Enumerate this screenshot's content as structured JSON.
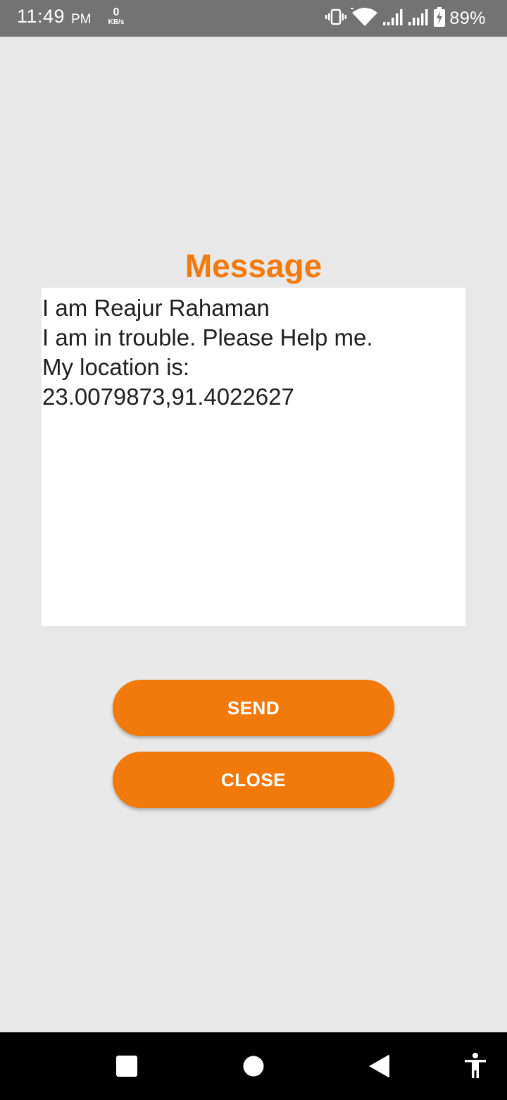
{
  "status_bar": {
    "time": "11:49",
    "ampm": "PM",
    "net_speed_value": "0",
    "net_speed_unit": "KB/s",
    "battery_percent": "89%",
    "icons": [
      "vibrate-icon",
      "wifi-icon",
      "signal-icon",
      "signal-icon",
      "battery-charging-icon"
    ],
    "background_color": "#737373"
  },
  "main": {
    "title": "Message",
    "message_text": "I am Reajur Rahaman\nI am in trouble. Please Help me.\nMy location is:\n23.0079873,91.4022627",
    "send_label": "SEND",
    "close_label": "CLOSE",
    "accent_color": "#f27a0d",
    "background_color": "#e8e8e8"
  },
  "nav_bar": {
    "icons": [
      "recents-square-icon",
      "home-circle-icon",
      "back-triangle-icon",
      "accessibility-icon"
    ]
  }
}
